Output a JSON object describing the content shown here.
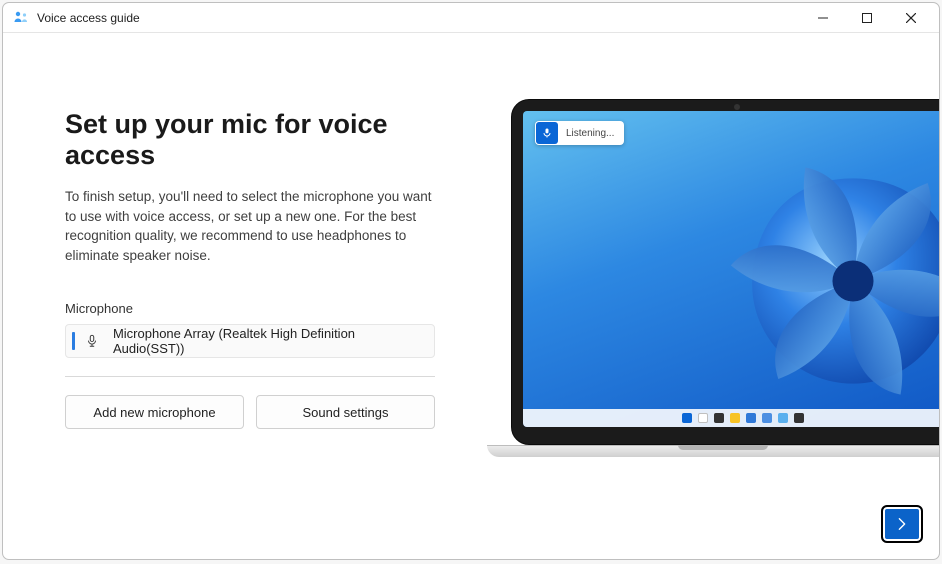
{
  "window": {
    "title": "Voice access guide"
  },
  "main": {
    "heading": "Set up your mic for voice access",
    "description": "To finish setup, you'll need to select the microphone you want to use with voice access, or set up a new one. For the best recognition quality, we recommend to use headphones to eliminate speaker noise.",
    "microphone_label": "Microphone",
    "selected_microphone": "Microphone Array (Realtek High Definition Audio(SST))",
    "buttons": {
      "add_microphone": "Add new microphone",
      "sound_settings": "Sound settings"
    }
  },
  "preview": {
    "status_text": "Listening..."
  },
  "icons": {
    "accent_blue": "#0a66d6"
  }
}
